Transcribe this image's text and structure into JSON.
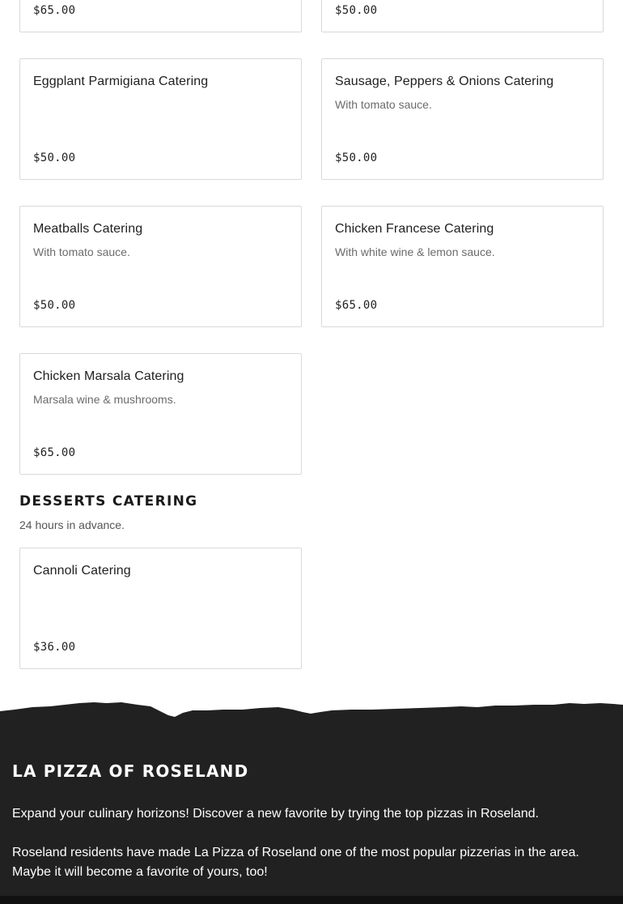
{
  "entrees_partial": {
    "top_left_price": "$65.00",
    "top_right_price": "$50.00",
    "items": [
      {
        "name": "Eggplant Parmigiana Catering",
        "description": "",
        "price": "$50.00"
      },
      {
        "name": "Sausage, Peppers & Onions Catering",
        "description": "With tomato sauce.",
        "price": "$50.00"
      },
      {
        "name": "Meatballs Catering",
        "description": "With tomato sauce.",
        "price": "$50.00"
      },
      {
        "name": "Chicken Francese Catering",
        "description": "With white wine & lemon sauce.",
        "price": "$65.00"
      },
      {
        "name": "Chicken Marsala Catering",
        "description": "Marsala wine & mushrooms.",
        "price": "$65.00"
      }
    ]
  },
  "desserts": {
    "title": "DESSERTS CATERING",
    "subtitle": "24 hours in advance.",
    "items": [
      {
        "name": "Cannoli Catering",
        "description": "",
        "price": "$36.00"
      }
    ]
  },
  "footer": {
    "brand": "LA PIZZA OF ROSELAND",
    "paragraph_1": "Expand your culinary horizons! Discover a new favorite by trying the top pizzas in Roseland.",
    "paragraph_2": "Roseland residents have made La Pizza of Roseland one of the most popular pizzerias in the area. Maybe it will become a favorite of yours, too!"
  },
  "colors": {
    "footer_bg": "#222121",
    "card_border": "#d9d9d9",
    "text_primary": "#1f1f1f",
    "text_muted": "#6b6b6b"
  }
}
